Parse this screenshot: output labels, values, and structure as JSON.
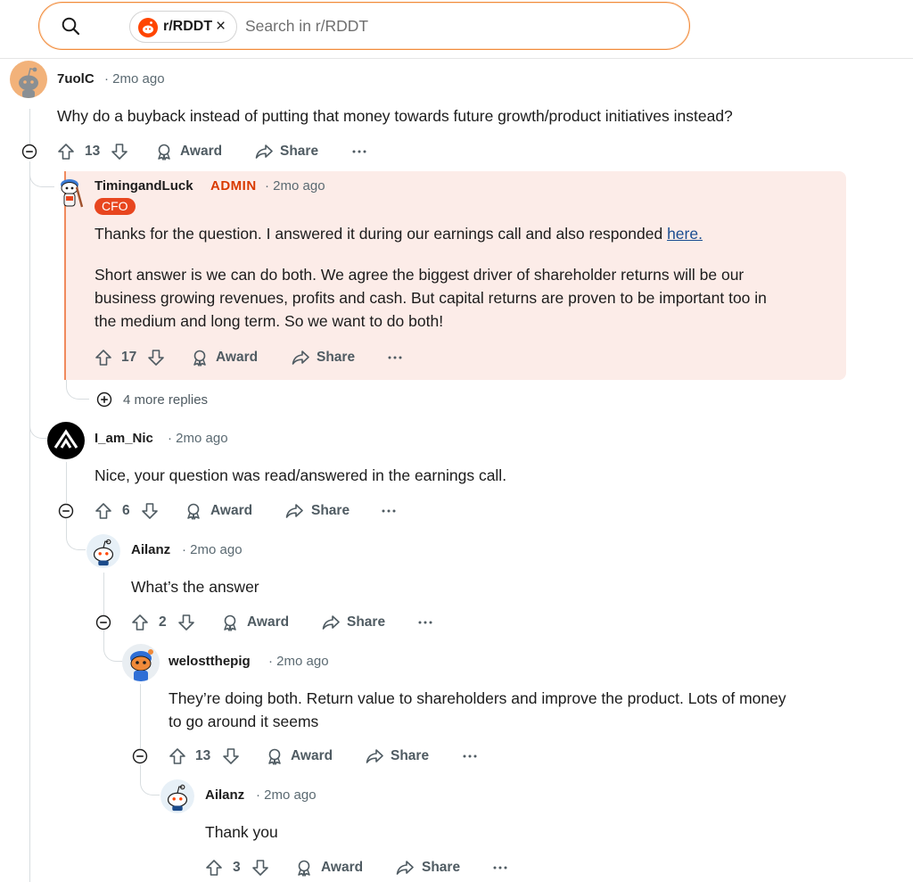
{
  "search": {
    "community_chip": "r/RDDT",
    "placeholder": "Search in r/RDDT"
  },
  "colors": {
    "accent": "#ff4500",
    "admin": "#d93a00",
    "flair_bg": "#e8461f",
    "highlight_bg": "#fcece8",
    "link": "#1a4d91"
  },
  "comments": [
    {
      "username": "7uolC",
      "time": "2mo ago",
      "body": "Why do a buyback instead of putting that money towards future growth/product initiatives instead?",
      "votes": "13",
      "award": "Award",
      "share": "Share",
      "more": "···"
    },
    {
      "username": "TimingandLuck",
      "role": "ADMIN",
      "time": "2mo ago",
      "flair": "CFO",
      "body_p1": "Thanks for the question. I answered it during our earnings call and also responded ",
      "body_link": "here.",
      "body_p2_l1": "Short answer is we can do both. We agree the biggest driver of shareholder returns will be our",
      "body_p2_l2": "business growing revenues, profits and cash. But capital returns are proven to be important too in",
      "body_p2_l3": "the medium and long term. So we want to do both!",
      "votes": "17",
      "award": "Award",
      "share": "Share",
      "more": "···"
    },
    {
      "more_replies": "4 more replies"
    },
    {
      "username": "I_am_Nic",
      "time": "2mo ago",
      "body": "Nice, your question was read/answered in the earnings call.",
      "votes": "6",
      "award": "Award",
      "share": "Share",
      "more": "···"
    },
    {
      "username": "Ailanz",
      "time": "2mo ago",
      "body": "What’s the answer",
      "votes": "2",
      "award": "Award",
      "share": "Share",
      "more": "···"
    },
    {
      "username": "welostthepig",
      "time": "2mo ago",
      "body_l1": "They’re doing both. Return value to shareholders and improve the product. Lots of money",
      "body_l2": "to go around it seems",
      "votes": "13",
      "award": "Award",
      "share": "Share",
      "more": "···"
    },
    {
      "username": "Ailanz",
      "time": "2mo ago",
      "body": "Thank you",
      "votes": "3",
      "award": "Award",
      "share": "Share",
      "more": "···"
    }
  ]
}
